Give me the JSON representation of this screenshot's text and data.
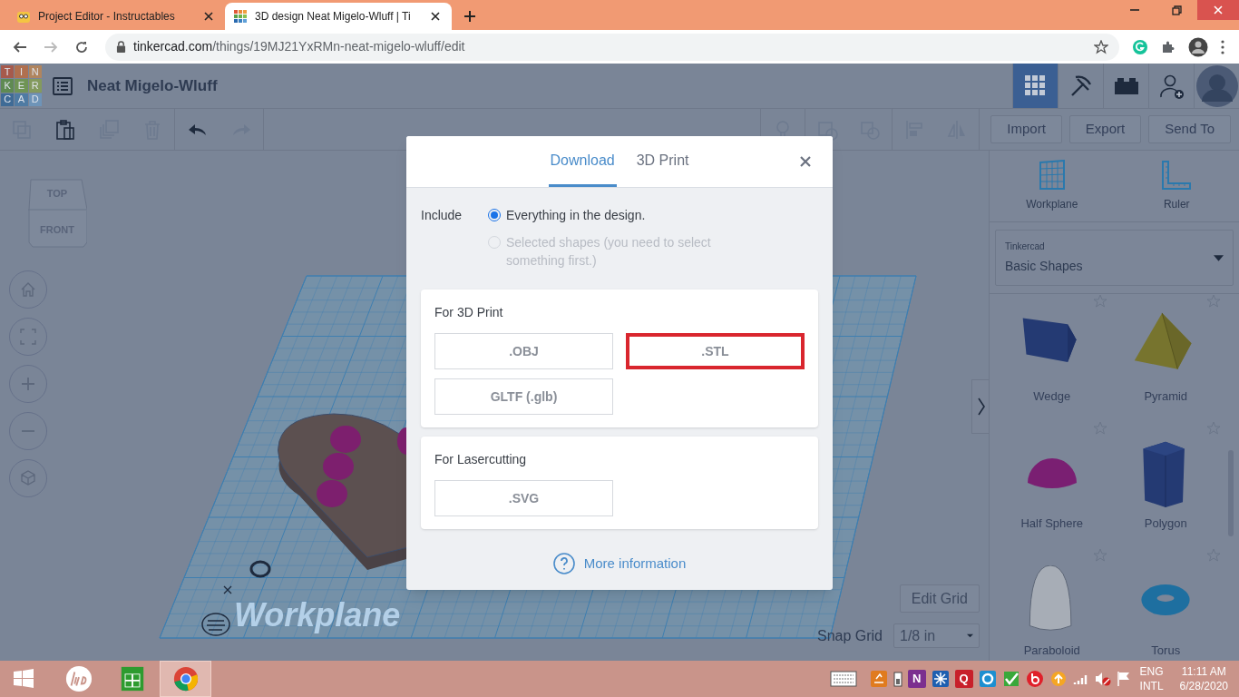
{
  "browser": {
    "tabs": [
      {
        "title": "Project Editor - Instructables",
        "selected": false
      },
      {
        "title": "3D design Neat Migelo-Wluff | Ti",
        "selected": true
      }
    ],
    "url": {
      "host": "tinkercad.com",
      "path": "/things/19MJ21YxRMn-neat-migelo-wluff/edit"
    }
  },
  "app": {
    "logo_letters": [
      "T",
      "I",
      "N",
      "K",
      "E",
      "R",
      "C",
      "A",
      "D"
    ],
    "design_title": "Neat Migelo-Wluff",
    "nav": [
      {
        "kind": "grid",
        "selected": true
      },
      {
        "kind": "pickaxe",
        "selected": false
      },
      {
        "kind": "brick",
        "selected": false
      },
      {
        "kind": "add-user",
        "selected": false
      }
    ],
    "tools": [
      {
        "kind": "copy",
        "disabled": true
      },
      {
        "kind": "paste",
        "disabled": false
      },
      {
        "kind": "duplicate",
        "disabled": true
      },
      {
        "kind": "delete",
        "disabled": true
      },
      {
        "kind": "undo",
        "disabled": false
      },
      {
        "kind": "redo",
        "disabled": true
      }
    ],
    "shape_tools": [
      {
        "kind": "note",
        "disabled": true
      },
      {
        "kind": "group",
        "disabled": true
      },
      {
        "kind": "ungroup",
        "disabled": true
      },
      {
        "kind": "align",
        "disabled": true
      },
      {
        "kind": "mirror",
        "disabled": true
      }
    ],
    "actions": [
      "Import",
      "Export",
      "Send To"
    ]
  },
  "view_cube": {
    "top": "TOP",
    "front": "FRONT"
  },
  "view_controls": [
    {
      "kind": "home"
    },
    {
      "kind": "fit"
    },
    {
      "kind": "zoom-in"
    },
    {
      "kind": "zoom-out"
    },
    {
      "kind": "ortho"
    }
  ],
  "workplane_label": "Workplane",
  "grid": {
    "edit_button": "Edit Grid",
    "snap_label": "Snap Grid",
    "snap_value": "1/8 in"
  },
  "panel": {
    "tools": [
      {
        "label": "Workplane",
        "kind": "workplane"
      },
      {
        "label": "Ruler",
        "kind": "ruler"
      }
    ],
    "library": {
      "caption": "Tinkercad",
      "value": "Basic Shapes"
    },
    "shapes": [
      {
        "label": "Wedge",
        "kind": "wedge"
      },
      {
        "label": "Pyramid",
        "kind": "pyramid"
      },
      {
        "label": "Half Sphere",
        "kind": "half-sphere"
      },
      {
        "label": "Polygon",
        "kind": "polygon"
      },
      {
        "label": "Paraboloid",
        "kind": "paraboloid"
      },
      {
        "label": "Torus",
        "kind": "torus"
      }
    ]
  },
  "dialog": {
    "tabs": [
      {
        "label": "Download",
        "selected": true
      },
      {
        "label": "3D Print",
        "selected": false
      }
    ],
    "include_label": "Include",
    "options": [
      {
        "label": "Everything in the design.",
        "selected": true,
        "disabled": false
      },
      {
        "label": "Selected shapes (you need to select something first.)",
        "selected": false,
        "disabled": true
      }
    ],
    "sections": [
      {
        "title": "For 3D Print",
        "formats": [
          {
            "label": ".OBJ",
            "highlighted": false
          },
          {
            "label": ".STL",
            "highlighted": true
          },
          {
            "label": "GLTF (.glb)",
            "highlighted": false
          }
        ]
      },
      {
        "title": "For Lasercutting",
        "formats": [
          {
            "label": ".SVG",
            "highlighted": false
          }
        ]
      }
    ],
    "more_info": "More information"
  },
  "taskbar": {
    "apps": [
      {
        "kind": "hp",
        "active": false
      },
      {
        "kind": "store",
        "active": false
      },
      {
        "kind": "chrome",
        "active": true
      }
    ],
    "tray": [
      {
        "kind": "keyboard"
      },
      {
        "kind": "app",
        "color": "#e07b1f"
      },
      {
        "kind": "battery"
      },
      {
        "kind": "letter",
        "glyph": "N",
        "color": "#7b2f8f"
      },
      {
        "kind": "snowflake",
        "color": "#1f5fb0"
      },
      {
        "kind": "letter",
        "glyph": "Q",
        "color": "#c8202a"
      },
      {
        "kind": "ring",
        "color": "#1d8fd0"
      },
      {
        "kind": "check",
        "color": "#3aa83a"
      },
      {
        "kind": "beats",
        "color": "#e0202a"
      },
      {
        "kind": "up",
        "color": "#f5a623"
      },
      {
        "kind": "signal"
      },
      {
        "kind": "speaker-muted"
      },
      {
        "kind": "flag"
      }
    ],
    "language": [
      "ENG",
      "INTL"
    ],
    "time": "11:11 AM",
    "date": "6/28/2020"
  }
}
